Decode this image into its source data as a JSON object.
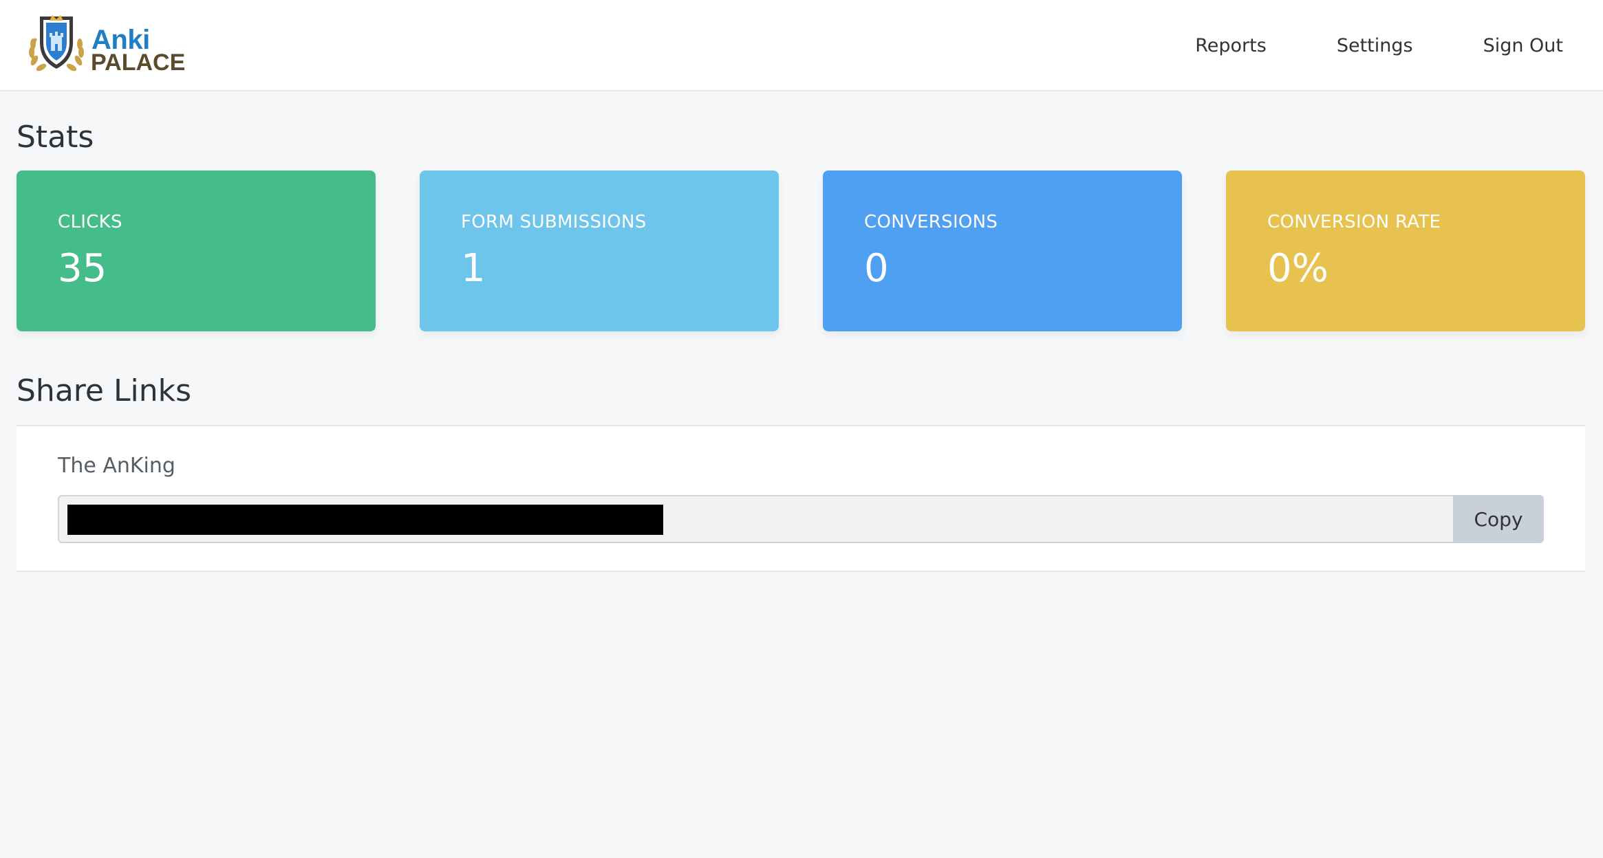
{
  "header": {
    "logo": {
      "line1": "Anki",
      "line2": "PALACE",
      "icon": "crest-logo-icon"
    },
    "nav": [
      {
        "label": "Reports"
      },
      {
        "label": "Settings"
      },
      {
        "label": "Sign Out"
      }
    ]
  },
  "stats": {
    "title": "Stats",
    "cards": [
      {
        "label": "CLICKS",
        "value": "35",
        "color": "#45bd8a"
      },
      {
        "label": "FORM SUBMISSIONS",
        "value": "1",
        "color": "#6ec5ec"
      },
      {
        "label": "CONVERSIONS",
        "value": "0",
        "color": "#4f9ff2"
      },
      {
        "label": "CONVERSION RATE",
        "value": "0%",
        "color": "#e8c24f"
      }
    ]
  },
  "share": {
    "title": "Share Links",
    "items": [
      {
        "name": "The AnKing",
        "copy_label": "Copy"
      }
    ]
  }
}
